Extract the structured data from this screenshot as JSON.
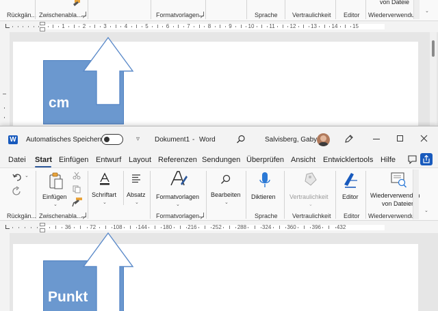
{
  "top_window": {
    "group_labels": [
      "Rückgän...",
      "Zwischenabla...",
      "Formatvorlagen",
      "Sprache",
      "Vertraulichkeit",
      "Editor",
      "Wiederverwendu"
    ],
    "partial_button_label": "von Dateie",
    "ruler_numbers": [
      "1",
      "2",
      "3",
      "4",
      "5",
      "6",
      "7",
      "8",
      "9",
      "10",
      "11",
      "12",
      "13",
      "14",
      "15"
    ],
    "box_text": "cm"
  },
  "title_bar": {
    "autosave_label": "Automatisches Speichern",
    "doc_title": "Dokument1",
    "separator": "-",
    "app_name": "Word",
    "user_name": "Salvisberg, Gaby"
  },
  "tabs": [
    "Datei",
    "Start",
    "Einfügen",
    "Entwurf",
    "Layout",
    "Referenzen",
    "Sendungen",
    "Überprüfen",
    "Ansicht",
    "Entwicklertools",
    "Hilfe"
  ],
  "active_tab": "Start",
  "ribbon": {
    "buttons": {
      "paste": "Einfügen",
      "font": "Schriftart",
      "paragraph": "Absatz",
      "styles": "Formatvorlagen",
      "editing": "Bearbeiten",
      "dictate": "Diktieren",
      "sensitivity": "Vertraulichkeit",
      "editor": "Editor",
      "reuse_line1": "Wiederverwenden",
      "reuse_line2": "von Dateien"
    },
    "group_labels": {
      "undo": "Rückgän...",
      "clipboard": "Zwischenabla...",
      "styles": "Formatvorlagen",
      "voice": "Sprache",
      "sensitivity": "Vertraulichkeit",
      "editor": "Editor",
      "reuse": "Wiederverwendu"
    }
  },
  "ruler_numbers": [
    "36",
    "72",
    "108",
    "144",
    "180",
    "216",
    "252",
    "288",
    "324",
    "360",
    "396",
    "432"
  ],
  "box_text": "Punkt",
  "colors": {
    "accent": "#2b579a",
    "box_fill": "#6b98cf",
    "word_blue": "#185abd"
  }
}
